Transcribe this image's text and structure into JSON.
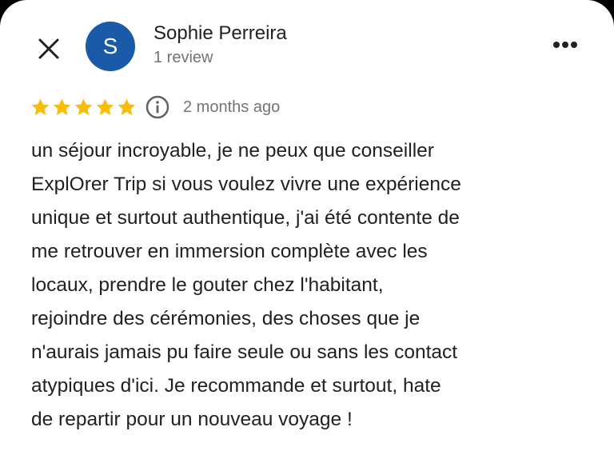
{
  "header": {
    "close_icon": "close-icon",
    "avatar_letter": "S",
    "reviewer_name": "Sophie Perreira",
    "review_count": "1 review",
    "more_icon": "more-horizontal-icon"
  },
  "rating": {
    "stars": 5,
    "max_stars": 5,
    "info_icon": "info-icon",
    "date": "2 months ago"
  },
  "review": {
    "lines": [
      "un séjour incroyable, je ne peux que conseiller",
      "ExplOrer Trip si vous voulez vivre une expérience",
      "unique et surtout authentique, j'ai été contente de",
      "me retrouver en immersion complète avec les",
      "locaux, prendre le gouter chez l'habitant,",
      "rejoindre des cérémonies, des choses que je",
      "n'aurais jamais pu faire seule ou sans les contact",
      "atypiques d'ici. Je recommande et surtout, hate",
      "de repartir pour un nouveau voyage !"
    ]
  },
  "colors": {
    "avatar_bg": "#1a5aa8",
    "star": "#fbbc04",
    "primary_text": "#202124",
    "secondary_text": "#70757a",
    "icon": "#202124"
  }
}
